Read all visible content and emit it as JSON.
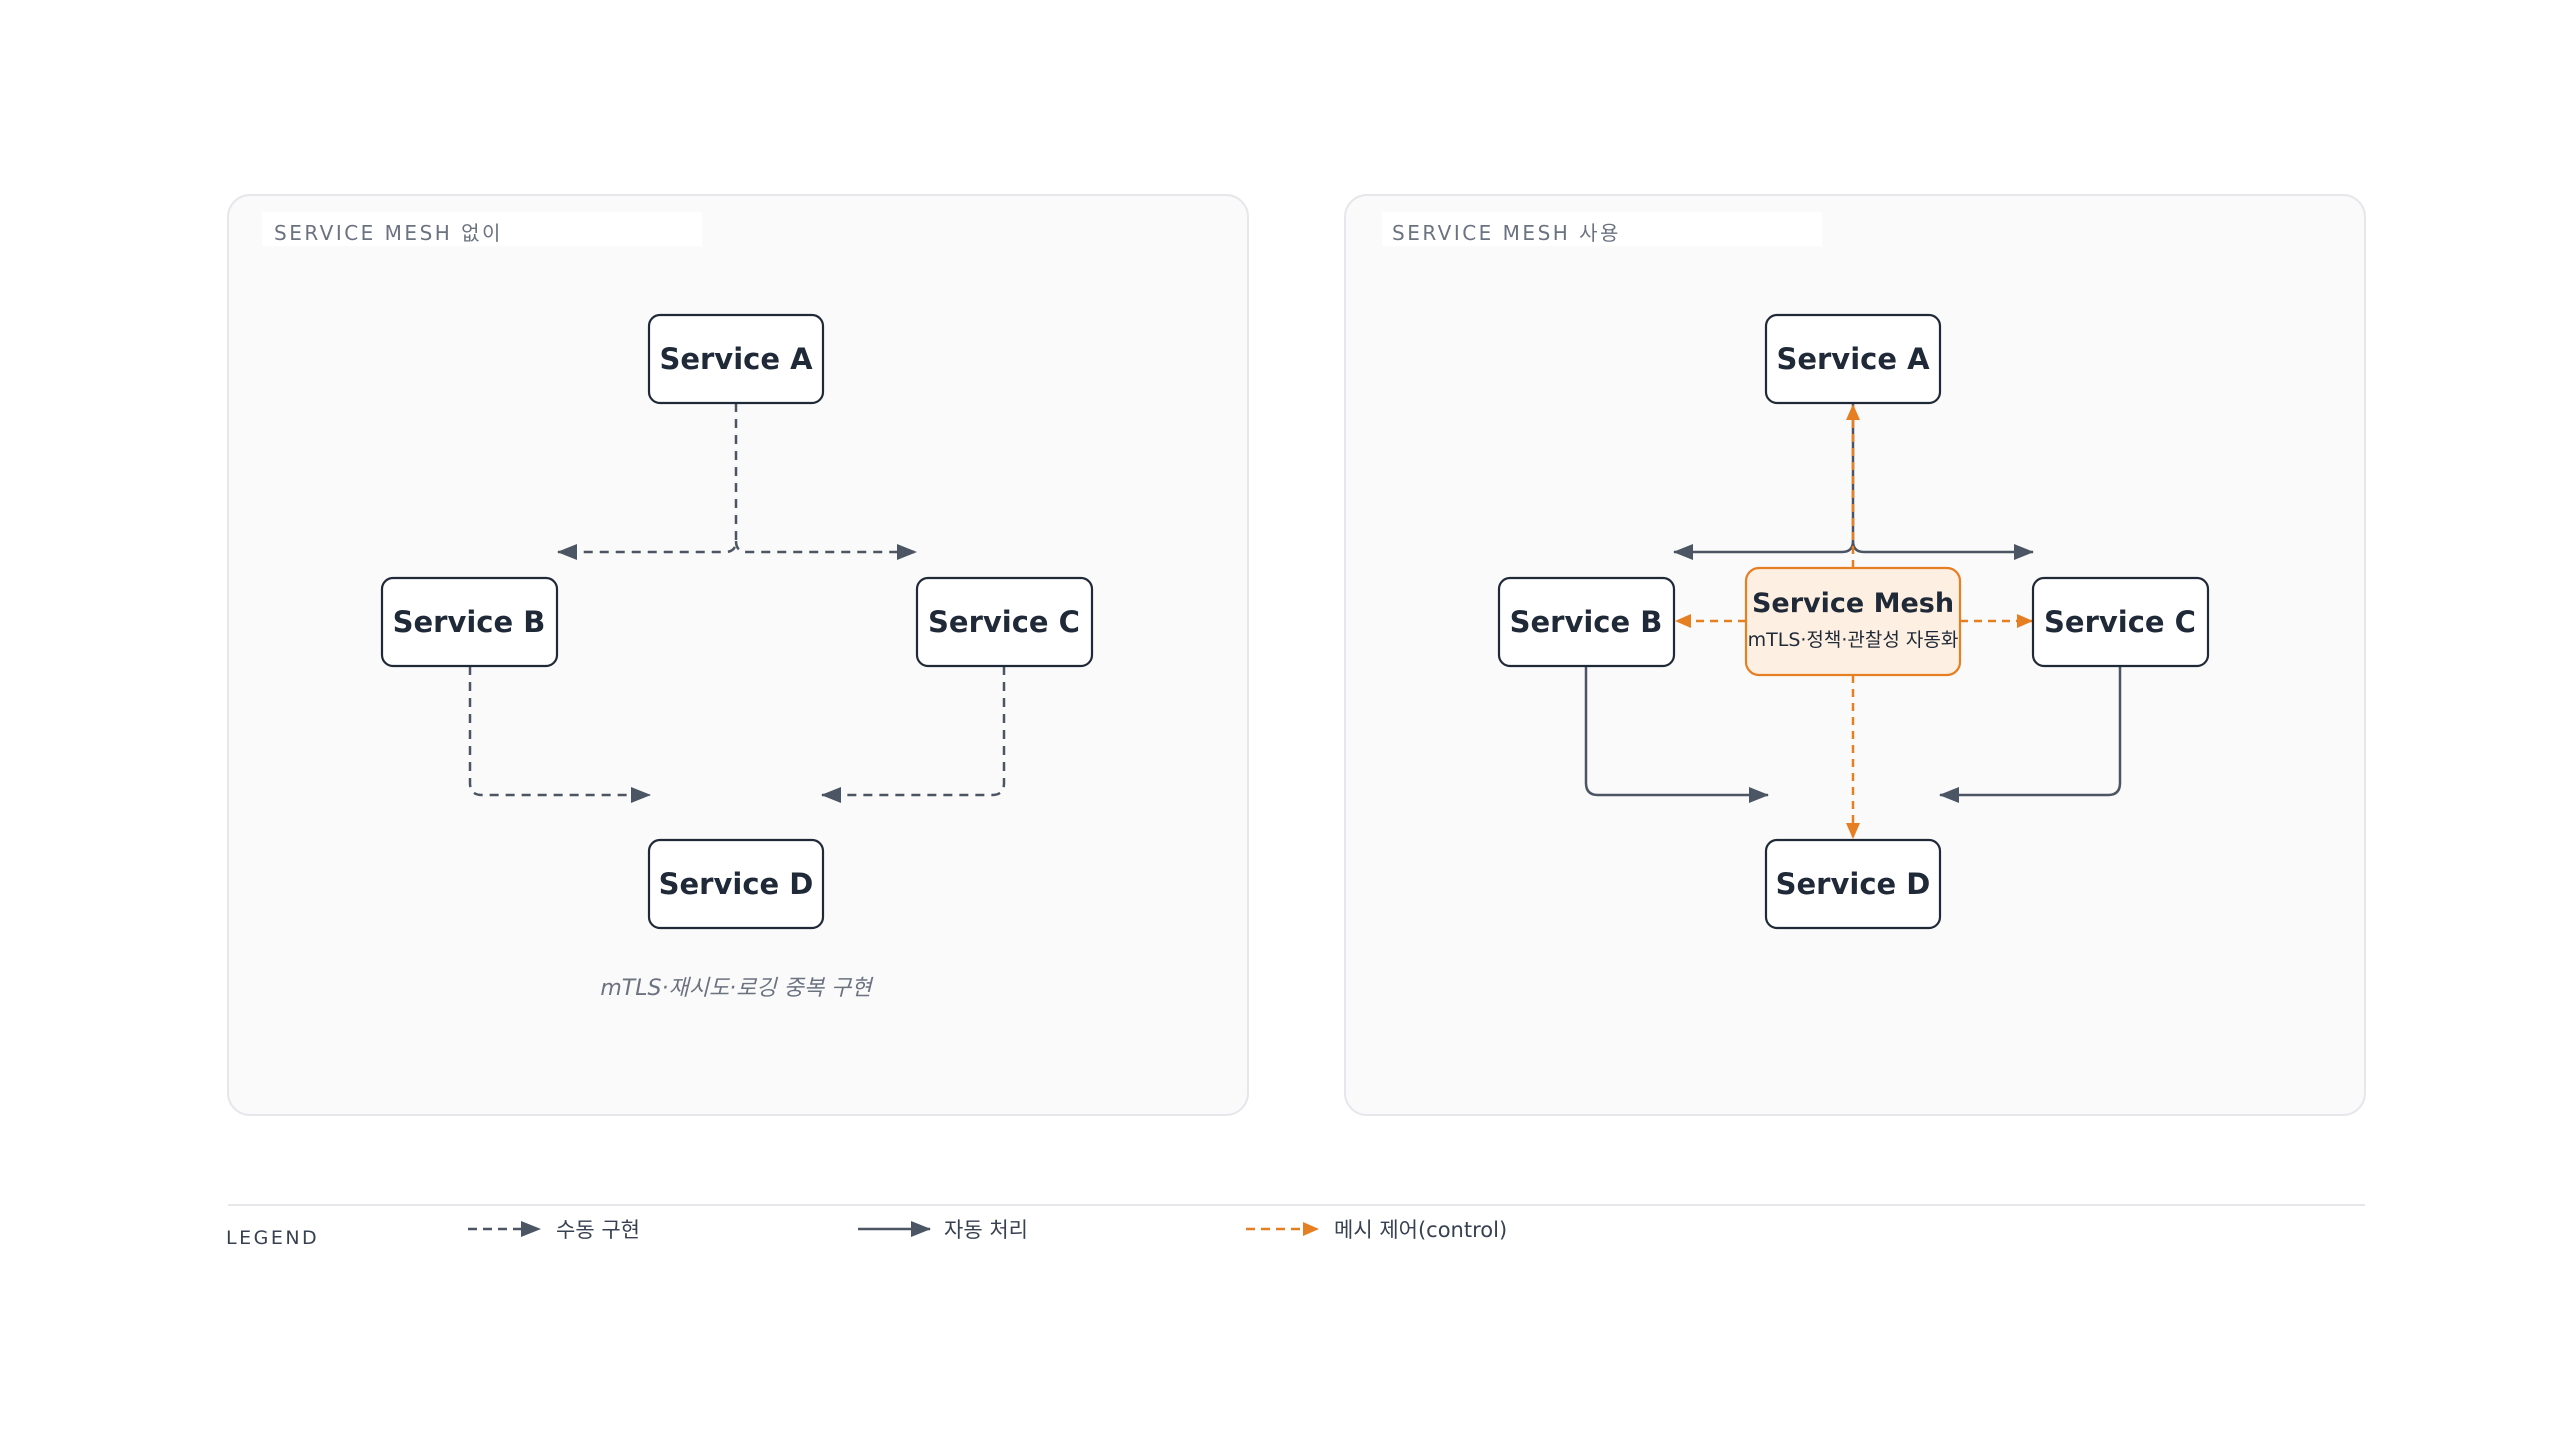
{
  "panels": {
    "left": {
      "title": "SERVICE MESH 없이",
      "nodes": {
        "a": "Service A",
        "b": "Service B",
        "c": "Service C",
        "d": "Service D"
      },
      "note": "mTLS·재시도·로깅 중복 구현"
    },
    "right": {
      "title": "SERVICE MESH 사용",
      "nodes": {
        "a": "Service A",
        "b": "Service B",
        "c": "Service C",
        "d": "Service D"
      },
      "mesh": {
        "title": "Service Mesh",
        "subtitle": "mTLS·정책·관찰성 자동화"
      }
    }
  },
  "legend": {
    "title": "LEGEND",
    "items": [
      {
        "label": "수동 구현",
        "style": "dashed-gray"
      },
      {
        "label": "자동 처리",
        "style": "solid-gray"
      },
      {
        "label": "메시 제어(control)",
        "style": "dashed-orange"
      }
    ]
  },
  "colors": {
    "manual": "#4b5563",
    "auto": "#4b5563",
    "control": "#e67e22",
    "mesh_fill": "#fdf0e2",
    "node_stroke": "#1f2937"
  }
}
